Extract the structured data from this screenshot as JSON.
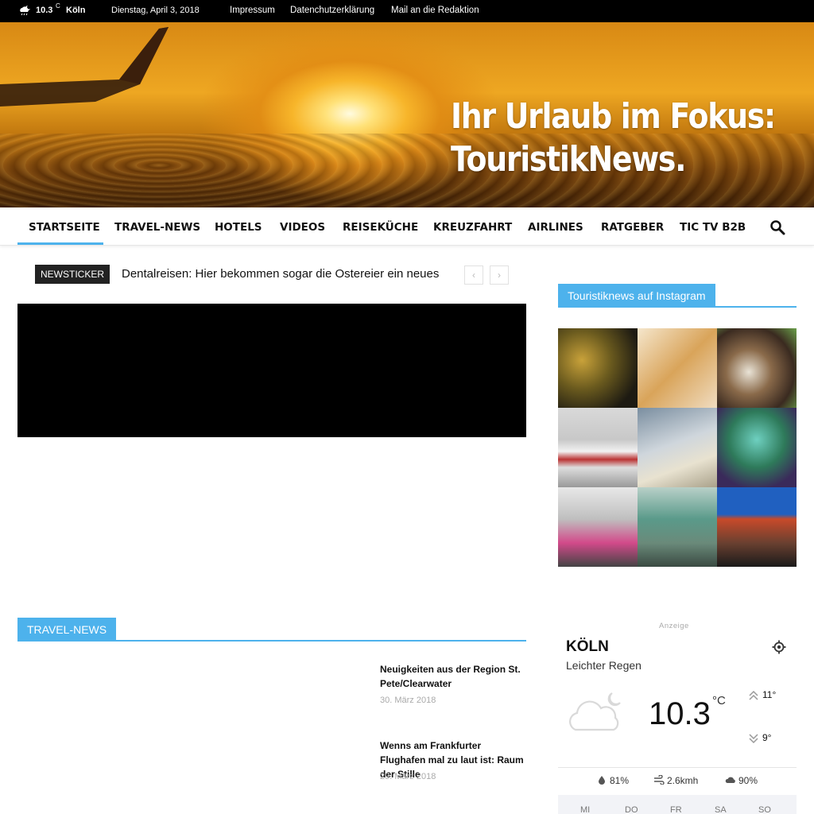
{
  "topbar": {
    "weather_icon": "cloud-rain-moon-icon",
    "temp": "10.3",
    "temp_unit": "C",
    "city": "Köln",
    "date": "Dienstag, April 3, 2018",
    "links": [
      "Impressum",
      "Datenchutzerklärung",
      "Mail an die Redaktion"
    ]
  },
  "banner": {
    "headline_line1": "Ihr Urlaub im Fokus:",
    "headline_line2": "TouristikNews."
  },
  "nav": {
    "items": [
      "STARTSEITE",
      "TRAVEL-NEWS",
      "HOTELS",
      "VIDEOS",
      "REISEKÜCHE",
      "KREUZFAHRT",
      "AIRLINES",
      "RATGEBER",
      "TIC TV B2B"
    ],
    "active": "STARTSEITE",
    "accent": "#4db2ec"
  },
  "ticker": {
    "label": "NEWSTICKER",
    "text": "Dentalreisen: Hier bekommen sogar die Ostereier ein neues",
    "prev": "‹",
    "next": "›"
  },
  "sidebar": {
    "instagram_title": "Touristiknews auf Instagram",
    "ad_label": "Anzeige"
  },
  "travel_news": {
    "title": "TRAVEL-NEWS",
    "items": [
      {
        "title": "Neuigkeiten aus der Region St. Pete/Clearwater",
        "date": "30. März 2018"
      },
      {
        "title": "Wenns am Frankfurter Flughafen mal zu laut ist: Raum der Stille",
        "date": "29. März 2018"
      }
    ]
  },
  "weather": {
    "city": "KÖLN",
    "description": "Leichter Regen",
    "temp": "10.3",
    "unit": "°C",
    "high": "11°",
    "low": "9°",
    "humidity": "81%",
    "wind": "2.6kmh",
    "clouds": "90%",
    "days": [
      "MI",
      "DO",
      "FR",
      "SA",
      "SO"
    ]
  }
}
